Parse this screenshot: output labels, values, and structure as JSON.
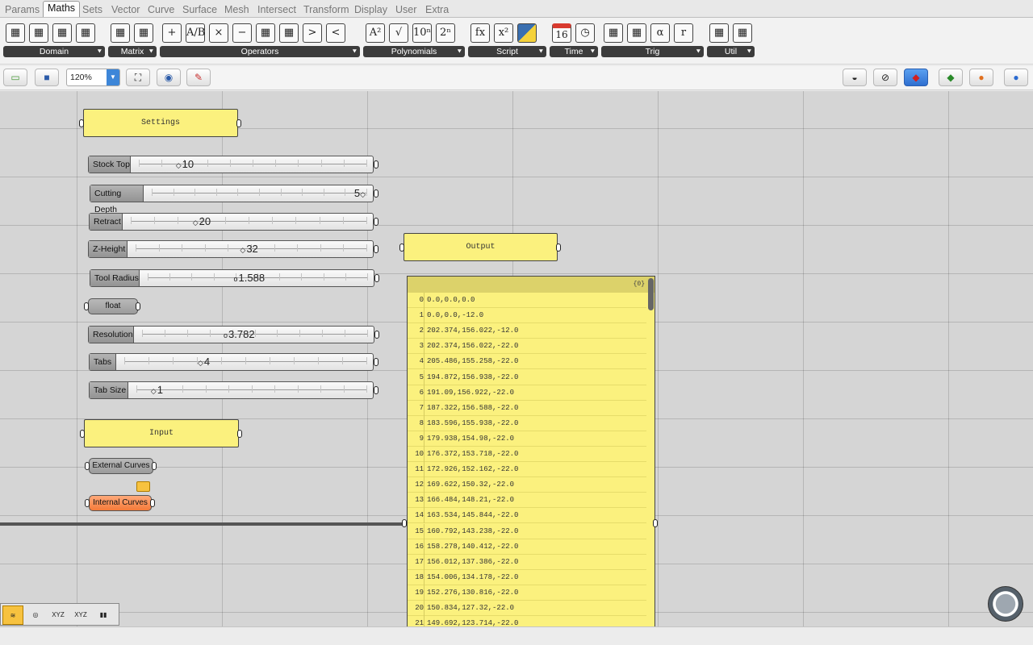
{
  "tabs": [
    "Params",
    "Maths",
    "Sets",
    "Vector",
    "Curve",
    "Surface",
    "Mesh",
    "Intersect",
    "Transform",
    "Display",
    "User",
    "Extra"
  ],
  "active_tab": "Maths",
  "ribbon_groups": [
    {
      "label": "Domain",
      "icons": [
        "domain-construct-icon",
        "domain-deconstruct-icon",
        "domain-bounds-icon",
        "domain-remap-icon"
      ]
    },
    {
      "label": "Matrix",
      "icons": [
        "matrix-construct-icon",
        "matrix-display-icon"
      ]
    },
    {
      "label": "Operators",
      "icons": [
        "addition-icon",
        "division-icon",
        "multiplication-icon",
        "subtraction-icon",
        "mass-addition-icon",
        "mass-multiplication-icon",
        "larger-than-icon",
        "smaller-than-icon"
      ]
    },
    {
      "label": "Polynomials",
      "icons": [
        "square-icon",
        "square-root-icon",
        "power-10-icon",
        "power-2-icon"
      ]
    },
    {
      "label": "Script",
      "icons": [
        "expression-icon",
        "evaluate-icon",
        "python-icon"
      ]
    },
    {
      "label": "Time",
      "icons": [
        "calendar-icon",
        "clock-icon"
      ]
    },
    {
      "label": "Trig",
      "icons": [
        "trig-right-icon",
        "trig-triangle-icon",
        "alpha-icon",
        "degrees-icon"
      ]
    },
    {
      "label": "Util",
      "icons": [
        "gaussian-icon",
        "graph-mapper-icon"
      ]
    }
  ],
  "ribbon_glyphs": {
    "addition-icon": "+",
    "division-icon": "A/B",
    "multiplication-icon": "×",
    "subtraction-icon": "−",
    "larger-than-icon": ">",
    "smaller-than-icon": "<",
    "square-icon": "A²",
    "square-root-icon": "√",
    "power-10-icon": "10ⁿ",
    "power-2-icon": "2ⁿ",
    "expression-icon": "fx",
    "evaluate-icon": "x²",
    "calendar-icon": "16",
    "clock-icon": "◷",
    "alpha-icon": "α",
    "degrees-icon": "r"
  },
  "toolbar": {
    "zoom": "120%"
  },
  "groups": {
    "settings": "Settings",
    "output": "Output",
    "input": "Input"
  },
  "sliders": [
    {
      "name": "stock-top-slider",
      "label": "Stock Top",
      "value": "10",
      "marker": "◇"
    },
    {
      "name": "cutting-depth-slider",
      "label": "Cutting Depth",
      "value": "5",
      "marker": "◇"
    },
    {
      "name": "retract-slider",
      "label": "Retract",
      "value": "20",
      "marker": "◇"
    },
    {
      "name": "z-height-slider",
      "label": "Z-Height",
      "value": "32",
      "marker": "◇"
    },
    {
      "name": "tool-radius-slider",
      "label": "Tool Radius",
      "value": "1.588",
      "marker": "o"
    },
    {
      "name": "resolution-slider",
      "label": "Resolution",
      "value": "3.782",
      "marker": "o"
    },
    {
      "name": "tabs-slider",
      "label": "Tabs",
      "value": "4",
      "marker": "◇"
    },
    {
      "name": "tab-size-slider",
      "label": "Tab Size",
      "value": "1",
      "marker": "◇"
    }
  ],
  "params": {
    "float": "float",
    "external_curves": "External Curves",
    "internal_curves": "Internal Curves"
  },
  "panel": {
    "header": "{0}",
    "rows": [
      "0.0,0.0,0.0",
      "0.0,0.0,-12.0",
      "202.374,156.022,-12.0",
      "202.374,156.022,-22.0",
      "205.486,155.258,-22.0",
      "194.872,156.938,-22.0",
      "191.09,156.922,-22.0",
      "187.322,156.588,-22.0",
      "183.596,155.938,-22.0",
      "179.938,154.98,-22.0",
      "176.372,153.718,-22.0",
      "172.926,152.162,-22.0",
      "169.622,150.32,-22.0",
      "166.484,148.21,-22.0",
      "163.534,145.844,-22.0",
      "160.792,143.238,-22.0",
      "158.278,140.412,-22.0",
      "156.012,137.386,-22.0",
      "154.006,134.178,-22.0",
      "152.276,130.816,-22.0",
      "150.834,127.32,-22.0",
      "149.692,123.714,-22.0"
    ]
  },
  "bottom_icons": [
    "points-preview-icon",
    "curve-preview-icon",
    "xyz-icon",
    "xyz-vector-icon",
    "bar-chart-icon"
  ],
  "bottom_glyphs": {
    "points-preview-icon": "≋",
    "curve-preview-icon": "◎",
    "xyz-icon": "XYZ",
    "xyz-vector-icon": "XYZ",
    "bar-chart-icon": "▮▮"
  }
}
